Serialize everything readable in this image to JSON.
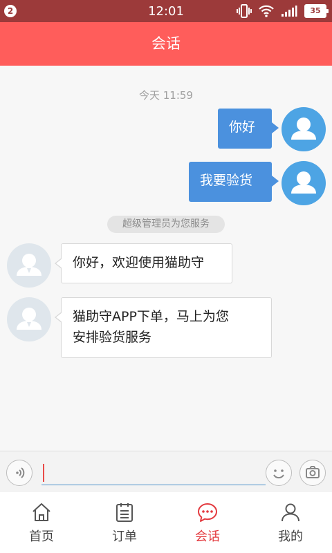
{
  "status_bar": {
    "notification_count": "2",
    "time": "12:01",
    "battery": "35",
    "icons": [
      "vibrate-icon",
      "wifi-icon",
      "signal-icon",
      "battery-icon"
    ]
  },
  "header": {
    "title": "会话"
  },
  "chat": {
    "timestamp": "今天 11:59",
    "system_notice": "超级管理员为您服务",
    "messages": [
      {
        "from": "user",
        "text": "你好"
      },
      {
        "from": "user",
        "text": "我要验货"
      },
      {
        "from": "admin",
        "text": "你好，欢迎使用猫助守"
      },
      {
        "from": "admin",
        "line1": "猫助守APP下单，马上为您",
        "line2": "安排验货服务"
      }
    ]
  },
  "input_bar": {
    "value": "",
    "voice_icon": "voice-icon",
    "emoji_icon": "emoji-icon",
    "camera_icon": "camera-icon"
  },
  "tabs": [
    {
      "label": "首页",
      "icon": "home-icon"
    },
    {
      "label": "订单",
      "icon": "order-icon"
    },
    {
      "label": "会话",
      "icon": "chat-icon",
      "active": true
    },
    {
      "label": "我的",
      "icon": "profile-icon"
    }
  ],
  "colors": {
    "status_bar": "#9c3a3a",
    "header": "#ff5d5b",
    "user_bubble": "#4b91de",
    "user_avatar": "#4da4e4",
    "admin_avatar": "#dfe6ec",
    "active_tab": "#e3393e"
  }
}
